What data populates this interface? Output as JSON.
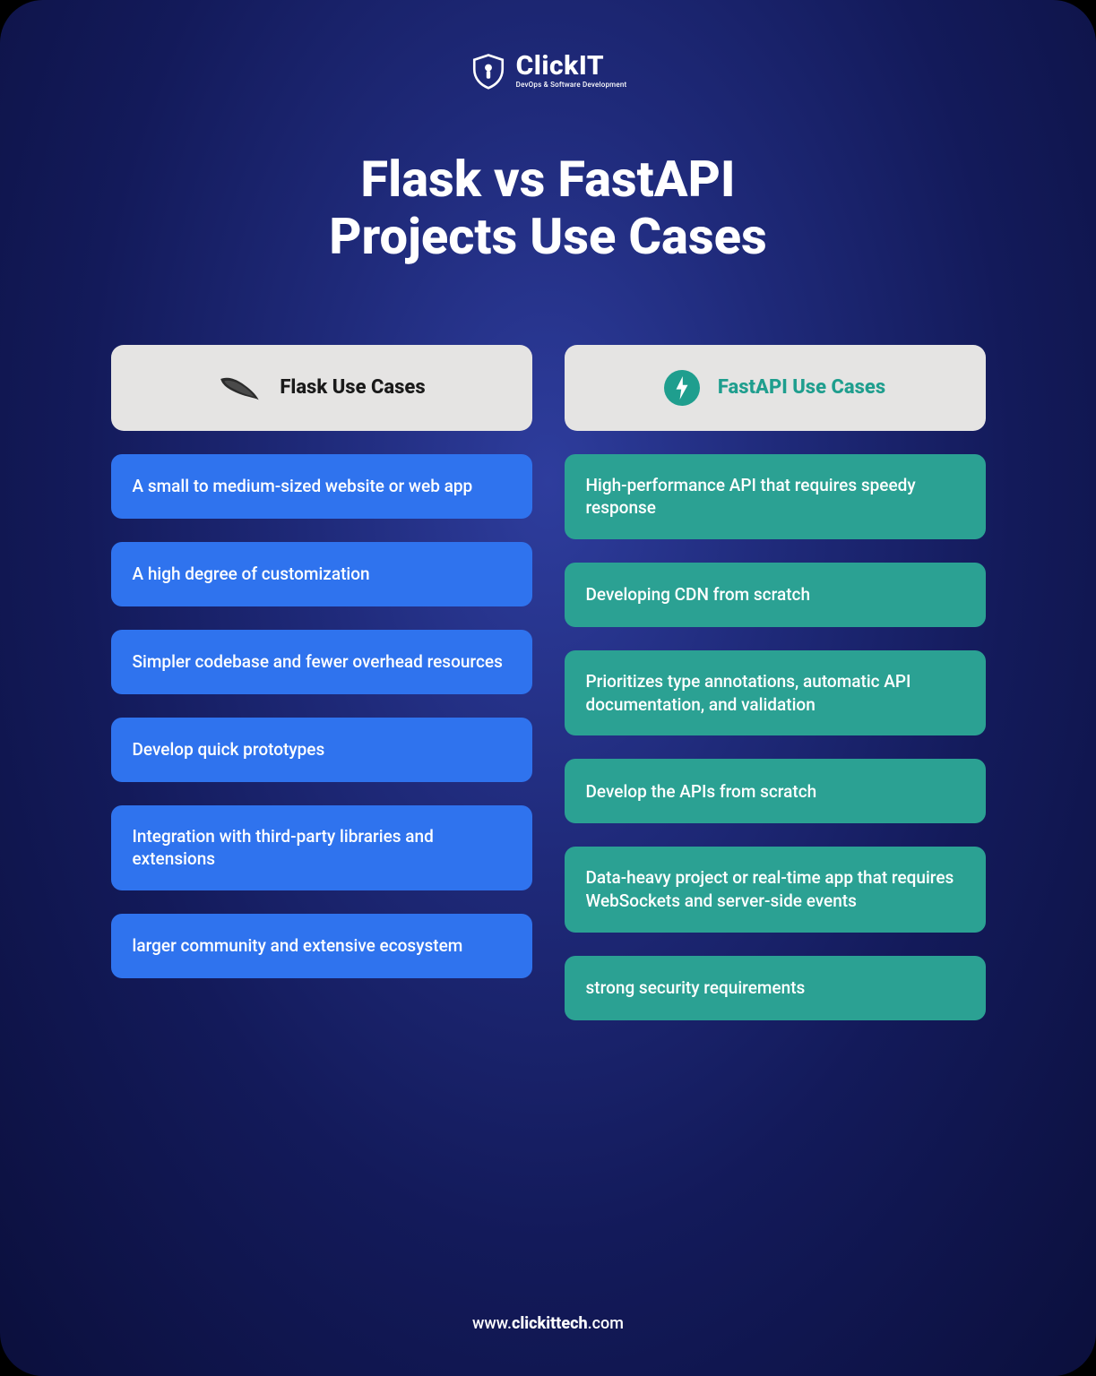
{
  "brand": {
    "name": "ClickIT",
    "tagline": "DevOps & Software Development"
  },
  "title_line1": "Flask vs FastAPI",
  "title_line2": "Projects Use Cases",
  "columns": {
    "flask": {
      "header": "Flask Use Cases",
      "items": [
        "A small to medium-sized website or web app",
        "A high degree of customization",
        "Simpler codebase and fewer overhead resources",
        "Develop quick prototypes",
        "Integration with third-party libraries and extensions",
        "larger community and extensive ecosystem"
      ]
    },
    "fastapi": {
      "header": "FastAPI Use Cases",
      "items": [
        "High-performance API that requires speedy response",
        "Developing CDN from scratch",
        "Prioritizes type annotations, automatic API documentation, and validation",
        "Develop the APIs from scratch",
        "Data-heavy project or real-time app that requires WebSockets and server-side events",
        "strong security requirements"
      ]
    }
  },
  "footer": {
    "prefix": "www.",
    "domain": "clickittech",
    "suffix": ".com"
  },
  "colors": {
    "flask_card": "#2f73ee",
    "fastapi_card": "#2ba193",
    "header_card_bg": "#e5e4e3",
    "fastapi_accent": "#1f9e8e"
  }
}
